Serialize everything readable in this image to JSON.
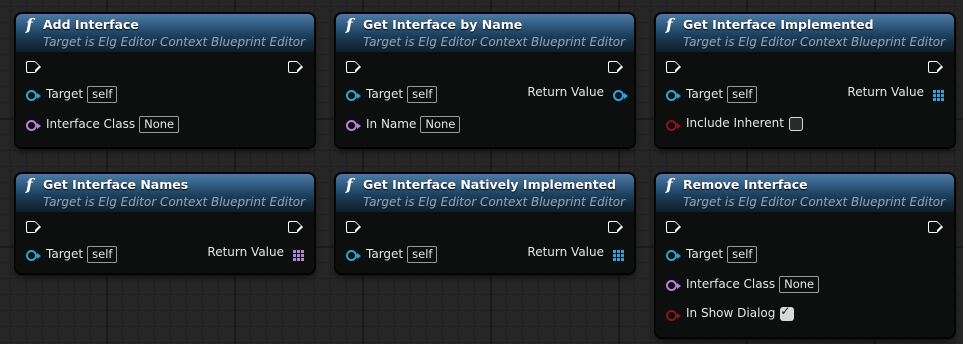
{
  "nodes": [
    {
      "title": "Add Interface",
      "subtitle": "Target is Elg Editor Context Blueprint Editor",
      "target_label": "Target",
      "target_value": "self",
      "param_label": "Interface Class",
      "param_value": "None"
    },
    {
      "title": "Get Interface by Name",
      "subtitle": "Target is Elg Editor Context Blueprint Editor",
      "target_label": "Target",
      "target_value": "self",
      "return_label": "Return Value",
      "param_label": "In Name",
      "param_value": "None"
    },
    {
      "title": "Get Interface Implemented",
      "subtitle": "Target is Elg Editor Context Blueprint Editor",
      "target_label": "Target",
      "target_value": "self",
      "return_label": "Return Value",
      "param_label": "Include Inherent",
      "param_checked": false
    },
    {
      "title": "Get Interface Names",
      "subtitle": "Target is Elg Editor Context Blueprint Editor",
      "target_label": "Target",
      "target_value": "self",
      "return_label": "Return Value"
    },
    {
      "title": "Get Interface Natively Implemented",
      "subtitle": "Target is Elg Editor Context Blueprint Editor",
      "target_label": "Target",
      "target_value": "self",
      "return_label": "Return Value"
    },
    {
      "title": "Remove Interface",
      "subtitle": "Target is Elg Editor Context Blueprint Editor",
      "target_label": "Target",
      "target_value": "self",
      "param_label": "Interface Class",
      "param_value": "None",
      "param2_label": "In Show Dialog",
      "param2_checked": true
    }
  ],
  "icons": {
    "function": "function-icon",
    "exec": "exec-pin-icon",
    "object_pin": "object-pin-icon",
    "class_pin": "class-pin-icon",
    "bool_pin": "bool-pin-icon",
    "array_pin": "array-pin-icon"
  },
  "colors": {
    "header_blue": "#335f86",
    "object_pin": "#2aa5df",
    "class_pin": "#b782de",
    "bool_pin": "#931313"
  }
}
